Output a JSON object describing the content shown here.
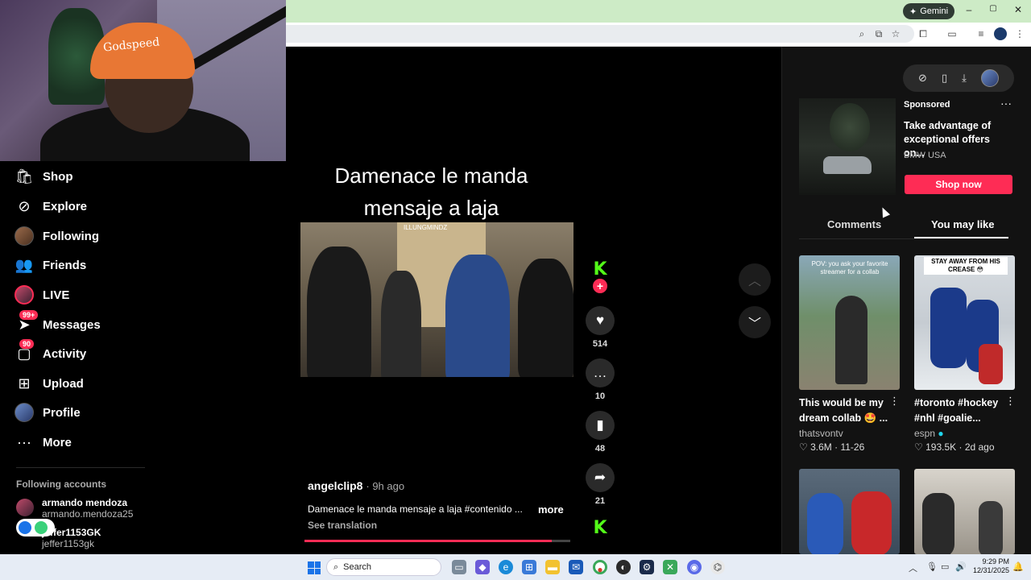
{
  "browser": {
    "gemini_label": "Gemini",
    "window_controls": [
      "–",
      "▢",
      "✕"
    ]
  },
  "webcam": {
    "cap_text": "Godspeed"
  },
  "nav": {
    "items": [
      {
        "label": "Shop",
        "icon": "shop-icon"
      },
      {
        "label": "Explore",
        "icon": "compass-icon"
      },
      {
        "label": "Following",
        "icon": "avatar"
      },
      {
        "label": "Friends",
        "icon": "friends-icon"
      },
      {
        "label": "LIVE",
        "icon": "avatar"
      },
      {
        "label": "Messages",
        "icon": "messages-icon",
        "badge": "99+"
      },
      {
        "label": "Activity",
        "icon": "activity-icon",
        "badge": "90"
      },
      {
        "label": "Upload",
        "icon": "upload-icon"
      },
      {
        "label": "Profile",
        "icon": "avatar"
      },
      {
        "label": "More",
        "icon": "more-icon"
      }
    ],
    "following_header": "Following accounts",
    "accounts": [
      {
        "name": "armando mendoza",
        "username": "armando.mendoza25"
      },
      {
        "name": "jeffer1153GK",
        "username": "jeffer1153gk"
      }
    ]
  },
  "video": {
    "caption_overlay": "Damenace  le manda mensaje a laja",
    "thumb_label": "ILLUNGMINDZ",
    "likes": "514",
    "comments": "10",
    "saves": "48",
    "shares": "21",
    "author": "angelclip8",
    "posted": "9h ago",
    "description": "Damenace le manda mensaje a laja #contenido ...",
    "more_label": "more",
    "see_translation": "See translation",
    "progress": 0.93
  },
  "right_panel": {
    "sponsored_label": "Sponsored",
    "ad_title": "Take advantage of exceptional offers on...",
    "ad_brand": "BMW USA",
    "shop_now": "Shop now",
    "tabs": [
      "Comments",
      "You may like"
    ],
    "active_tab": "You may like",
    "recommendations": [
      {
        "thumb_text": "POV: you ask your favorite streamer for a collab",
        "caption": "This would be my dream collab 🤩 ...",
        "author": "thatsvontv",
        "likes": "3.6M",
        "date": "11-26"
      },
      {
        "thumb_text": "STAY AWAY FROM HIS CREASE 😳",
        "caption": "#toronto #hockey #nhl #goalie...",
        "author": "espn",
        "likes": "193.5K",
        "date": "2d ago"
      },
      {
        "thumb_text": "",
        "caption": "",
        "author": "",
        "likes": "",
        "date": ""
      },
      {
        "thumb_text": "",
        "caption": "",
        "author": "",
        "likes": "",
        "date": ""
      }
    ]
  },
  "taskbar": {
    "search_label": "Search",
    "time": "9:29 PM",
    "date": "12/31/2025"
  },
  "colors": {
    "accent": "#fe2c55",
    "kick_green": "#53fc18",
    "chrome_tab_bar": "#cdebc6"
  }
}
